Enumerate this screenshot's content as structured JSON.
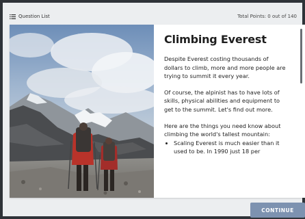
{
  "topbar": {
    "question_list_label": "Question List",
    "total_points": "Total Points: 0 out of 140"
  },
  "lesson": {
    "title": "Climbing Everest",
    "paragraphs": [
      "Despite Everest costing thousands of dollars to climb, more and more people are trying to summit it every year.",
      "Of course, the alpinist has to have lots of skills, physical abilities and equipment to get to the summit. Let's find out more.",
      "Here are the things you need know about climbing the world's tallest mountain:"
    ],
    "bullets": [
      "Scaling Everest is much easier than it used to be. In 1990 just 18 per"
    ]
  },
  "footer": {
    "continue_label": "CONTINUE"
  },
  "colors": {
    "button_bg": "#7d92b0",
    "card_bg": "#ffffff",
    "page_bg": "#eceef0"
  }
}
